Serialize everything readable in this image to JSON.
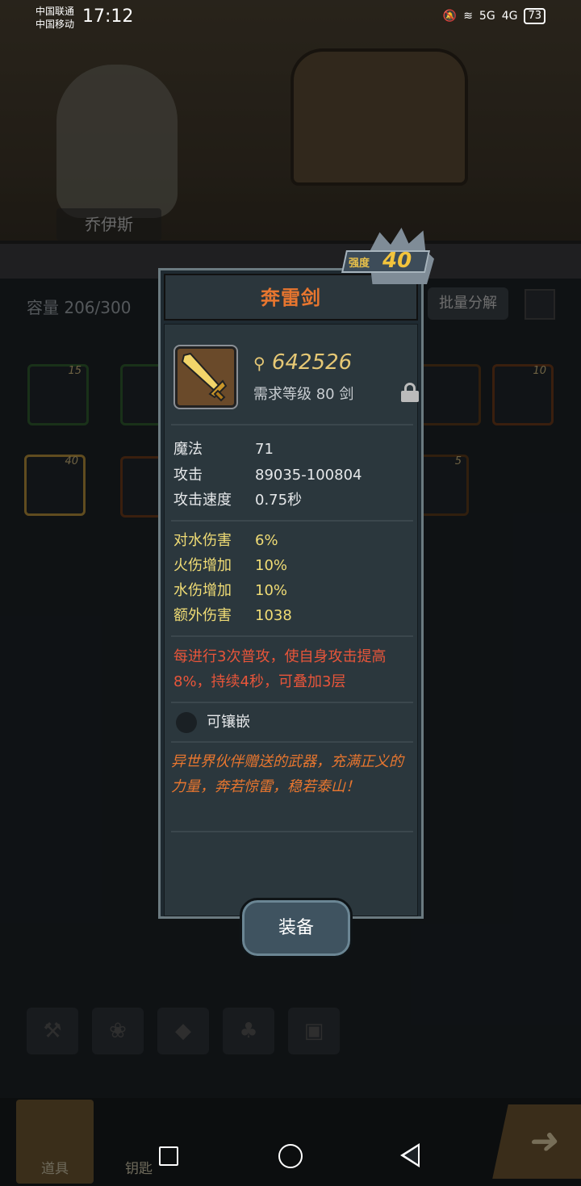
{
  "status_bar": {
    "carrier1": "中国联通",
    "carrier2": "中国移动",
    "time": "17:12",
    "net1": "5G",
    "net2": "4G",
    "battery": "73"
  },
  "hero": {
    "name": "乔伊斯"
  },
  "inventory": {
    "capacity": "容量 206/300",
    "batch_label": "批量分解",
    "slots": [
      {
        "level": "15"
      },
      {
        "level": "10"
      },
      {
        "level": "40"
      },
      {
        "level": "5"
      }
    ]
  },
  "bottom_tabs": [
    {
      "label": "道具"
    },
    {
      "label": "钥匙"
    }
  ],
  "popup": {
    "title": "奔雷剑",
    "strength_label": "强度",
    "strength_value": "40",
    "power": "642526",
    "requirement": "需求等级 80   剑",
    "base_stats": [
      {
        "name": "魔法",
        "value": "71"
      },
      {
        "name": "攻击",
        "value": "89035-100804"
      },
      {
        "name": "攻击速度",
        "value": "0.75秒"
      }
    ],
    "bonus_stats": [
      {
        "name": "对水伤害",
        "value": "6%"
      },
      {
        "name": "火伤增加",
        "value": "10%"
      },
      {
        "name": "水伤增加",
        "value": "10%"
      },
      {
        "name": "额外伤害",
        "value": "1038"
      }
    ],
    "skill": "每进行3次普攻，使自身攻击提高8%，持续4秒，可叠加3层",
    "socket_label": "可镶嵌",
    "lore": "异世界伙伴赠送的武器，充满正义的力量，奔若惊雷，稳若泰山！",
    "equip_label": "装备"
  },
  "colors": {
    "title_orange": "#e8762f",
    "bonus_yellow": "#f0dc75",
    "skill_red": "#e8553a",
    "power_gold": "#e6c875"
  }
}
